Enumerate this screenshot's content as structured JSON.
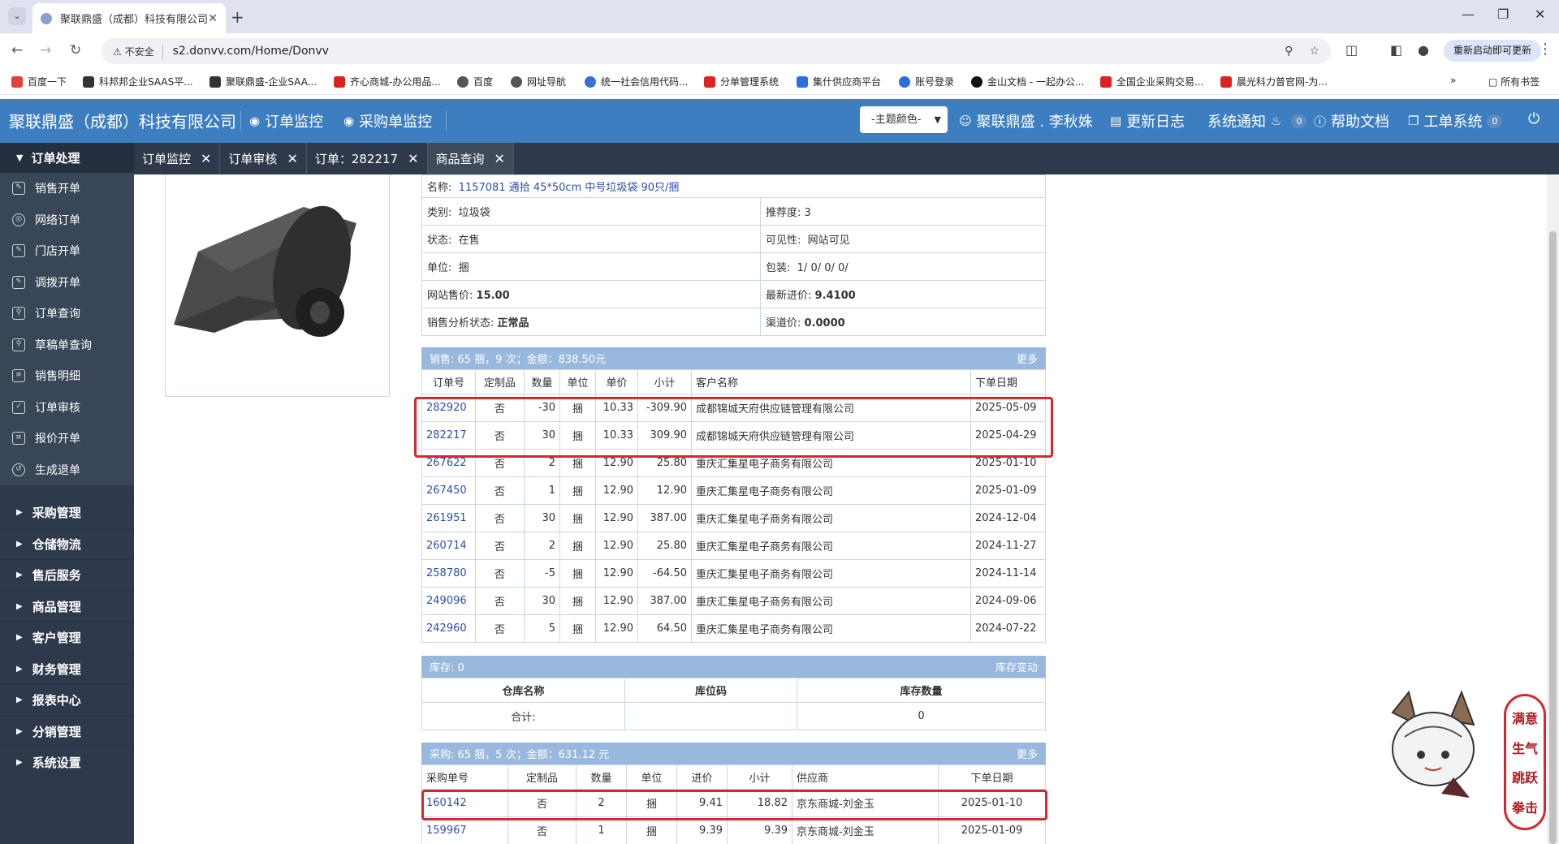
{
  "browser": {
    "tab_title": "聚联鼎盛（成都）科技有限公司",
    "insecure_label": "不安全",
    "url": "s2.donvv.com/Home/Donvv",
    "restart_label": "重新启动即可更新",
    "bookmarks": [
      "百度一下",
      "科邦邦企业SAAS平...",
      "聚联鼎盛-企业SAA...",
      "齐心商城-办公用品...",
      "百度",
      "网址导航",
      "统一社会信用代码...",
      "分单管理系统",
      "集什供应商平台",
      "账号登录",
      "金山文档 - 一起办公...",
      "全国企业采购交易...",
      "晨光科力普官网-为..."
    ],
    "all_bookmarks": "所有书签"
  },
  "header": {
    "brand": "聚联鼎盛（成都）科技有限公司",
    "nav_order_monitor": "订单监控",
    "nav_purchase_monitor": "采购单监控",
    "theme_select": "-主题颜色-",
    "user": "聚联鼎盛 . 李秋姝",
    "update_log": "更新日志",
    "system_notice": "系统通知",
    "notice_count": "0",
    "help_docs": "帮助文档",
    "ticket_system": "工单系统",
    "ticket_count": "0"
  },
  "sidebar": {
    "group": "订单处理",
    "items": [
      "销售开单",
      "网络订单",
      "门店开单",
      "调拨开单",
      "订单查询",
      "草稿单查询",
      "销售明细",
      "订单审核",
      "报价开单",
      "生成退单"
    ],
    "sections": [
      "采购管理",
      "仓储物流",
      "售后服务",
      "商品管理",
      "客户管理",
      "财务管理",
      "报表中心",
      "分销管理",
      "系统设置"
    ]
  },
  "content_tabs": [
    "订单监控",
    "订单审核",
    "订单：282217",
    "商品查询"
  ],
  "product": {
    "name_label": "名称:",
    "name_value": "1157081 通拾 45*50cm 中号垃圾袋 90只/捆",
    "category_label": "类别:",
    "category_value": "垃圾袋",
    "recommend_label": "推荐度:",
    "recommend_value": "3",
    "status_label": "状态:",
    "status_value": "在售",
    "visibility_label": "可见性:",
    "visibility_value": "网站可见",
    "unit_label": "单位:",
    "unit_value": "捆",
    "package_label": "包装:",
    "package_value": "1/ 0/ 0/ 0/",
    "web_price_label": "网站售价:",
    "web_price_value": "15.00",
    "latest_cost_label": "最新进价:",
    "latest_cost_value": "9.4100",
    "sales_status_label": "销售分析状态:",
    "sales_status_value": "正常品",
    "channel_price_label": "渠道价:",
    "channel_price_value": "0.0000"
  },
  "sales": {
    "summary": "销售:  65 捆，9 次；金额：838.50元",
    "more": "更多",
    "headers": [
      "订单号",
      "定制品",
      "数量",
      "单位",
      "单价",
      "小计",
      "客户名称",
      "下单日期"
    ],
    "rows": [
      [
        "282920",
        "否",
        "-30",
        "捆",
        "10.33",
        "-309.90",
        "成都锦城天府供应链管理有限公司",
        "2025-05-09"
      ],
      [
        "282217",
        "否",
        "30",
        "捆",
        "10.33",
        "309.90",
        "成都锦城天府供应链管理有限公司",
        "2025-04-29"
      ],
      [
        "267622",
        "否",
        "2",
        "捆",
        "12.90",
        "25.80",
        "重庆汇集星电子商务有限公司",
        "2025-01-10"
      ],
      [
        "267450",
        "否",
        "1",
        "捆",
        "12.90",
        "12.90",
        "重庆汇集星电子商务有限公司",
        "2025-01-09"
      ],
      [
        "261951",
        "否",
        "30",
        "捆",
        "12.90",
        "387.00",
        "重庆汇集星电子商务有限公司",
        "2024-12-04"
      ],
      [
        "260714",
        "否",
        "2",
        "捆",
        "12.90",
        "25.80",
        "重庆汇集星电子商务有限公司",
        "2024-11-27"
      ],
      [
        "258780",
        "否",
        "-5",
        "捆",
        "12.90",
        "-64.50",
        "重庆汇集星电子商务有限公司",
        "2024-11-14"
      ],
      [
        "249096",
        "否",
        "30",
        "捆",
        "12.90",
        "387.00",
        "重庆汇集星电子商务有限公司",
        "2024-09-06"
      ],
      [
        "242960",
        "否",
        "5",
        "捆",
        "12.90",
        "64.50",
        "重庆汇集星电子商务有限公司",
        "2024-07-22"
      ]
    ]
  },
  "stock": {
    "summary": "库存:  0",
    "change_link": "库存变动",
    "headers": [
      "仓库名称",
      "库位码",
      "库存数量"
    ],
    "total_label": "合计:",
    "total_value": "0"
  },
  "purchase": {
    "summary": "采购:  65 捆，5 次；金额：631.12 元",
    "more": "更多",
    "headers": [
      "采购单号",
      "定制品",
      "数量",
      "单位",
      "进价",
      "小计",
      "供应商",
      "下单日期"
    ],
    "rows": [
      [
        "160142",
        "否",
        "2",
        "捆",
        "9.41",
        "18.82",
        "京东商城-刘金玉",
        "2025-01-10"
      ],
      [
        "159967",
        "否",
        "1",
        "捆",
        "9.39",
        "9.39",
        "京东商城-刘金玉",
        "2025-01-09"
      ]
    ]
  },
  "mood_widget": [
    "满意",
    "生气",
    "跳跃",
    "拳击"
  ]
}
